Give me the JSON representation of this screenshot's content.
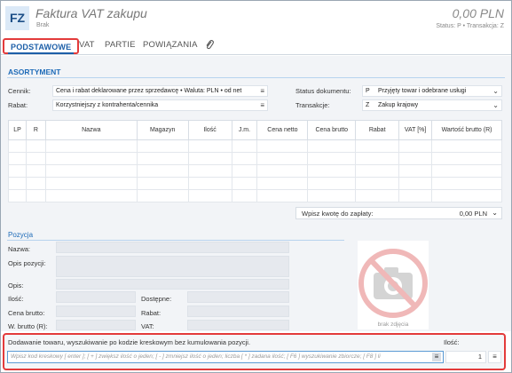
{
  "header": {
    "logo": "FZ",
    "title": "Faktura VAT zakupu",
    "subtitle": "Brak",
    "amount": "0,00 PLN",
    "status_line": "Status: P  •  Transakcja: Z"
  },
  "tabs": [
    {
      "label": "PODSTAWOWE",
      "active": true
    },
    {
      "label": "VAT"
    },
    {
      "label": "PARTIE"
    },
    {
      "label": "POWIĄZANIA"
    }
  ],
  "tab_icon": "paperclip-icon",
  "assortment": {
    "section_title": "ASORTYMENT",
    "cennik_label": "Cennik:",
    "cennik_value": "Cena i rabat deklarowane przez sprzedawcę • Waluta: PLN • od net",
    "rabat_label": "Rabat:",
    "rabat_value": "Korzystniejszy z kontrahenta/cennika",
    "status_label": "Status dokumentu:",
    "status_code": "P",
    "status_value": "Przyjęty towar i odebrane usługi",
    "transakcja_label": "Transakcje:",
    "transakcja_code": "Z",
    "transakcja_value": "Zakup krajowy"
  },
  "grid": {
    "columns": [
      "LP",
      "R",
      "Nazwa",
      "Magazyn",
      "Ilość",
      "J.m.",
      "Cena netto",
      "Cena brutto",
      "Rabat",
      "VAT [%]",
      "Wartość brutto (R)"
    ],
    "empty_rows": 5
  },
  "payment": {
    "label": "Wpisz kwotę do zapłaty:",
    "value": "0,00 PLN"
  },
  "position": {
    "section_title": "Pozycja",
    "nazwa_label": "Nazwa:",
    "opis_pozycji_label": "Opis pozycji:",
    "opis_label": "Opis:",
    "ilosc_label": "Ilość:",
    "dostepne_label": "Dostępne:",
    "cena_brutto_label": "Cena brutto:",
    "rabat_label": "Rabat:",
    "w_brutto_label": "W. brutto (R):",
    "vat_label": "VAT:",
    "no_image_text": "brak zdjęcia"
  },
  "scan": {
    "label": "Dodawanie towaru, wyszukiwanie po kodzie kreskowym bez kumulowania pozycji.",
    "qty_label": "Ilość:",
    "placeholder": "Wpisz kod kreskowy [ enter ]; [ + ] zwiększ ilość o jeden; [ - ] zmniejsz ilość o jeden; liczba [ * ] zadana ilość; [ F6 ] wyszukiwanie zbiorcze; [ F8 ] li",
    "qty_value": "1"
  },
  "colors": {
    "accent": "#1d5fa8",
    "highlight": "#e33b3b",
    "panel": "#f2f4f7"
  }
}
